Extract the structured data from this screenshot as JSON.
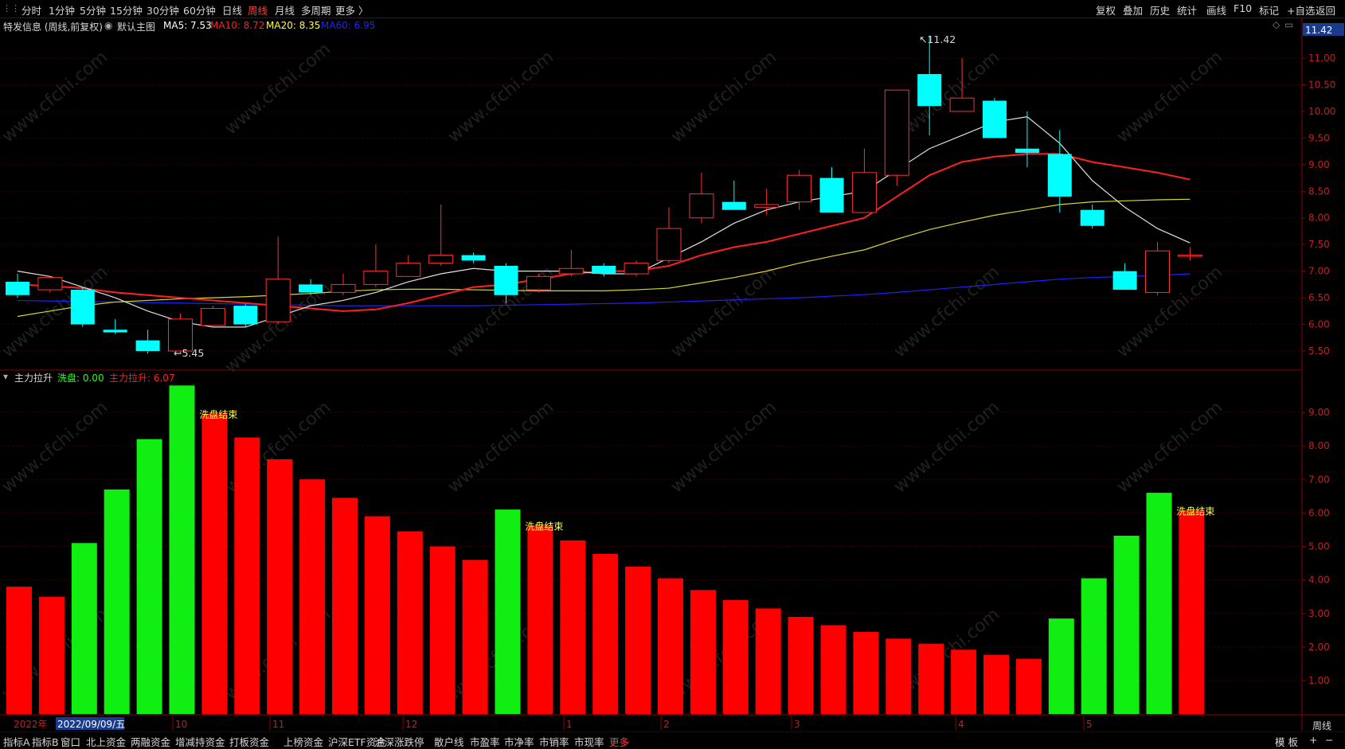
{
  "topbar": {
    "periods": [
      "分时",
      "1分钟",
      "5分钟",
      "15分钟",
      "30分钟",
      "60分钟",
      "日线",
      "周线",
      "月线",
      "多周期",
      "更多 〉"
    ],
    "active_period": "周线",
    "right_tools": [
      "复权",
      "叠加",
      "历史",
      "统计",
      "画线",
      "F10",
      "标记",
      "+自选",
      "返回"
    ]
  },
  "main_chart": {
    "stock_label": "特发信息 (周线,前复权)",
    "template_label": "默认主图",
    "ma5": {
      "label": "MA5: 7.53",
      "color": "#ffffff"
    },
    "ma10": {
      "label": "MA10: 8.72",
      "color": "#ff2020"
    },
    "ma20": {
      "label": "MA20: 8.35",
      "color": "#ffff40"
    },
    "ma60": {
      "label": "MA60: 6.95",
      "color": "#2020ff"
    },
    "high_marker": "11.42",
    "low_marker": "5.45",
    "price_badge": "11.42",
    "y_ticks": [
      "11.00",
      "10.50",
      "10.00",
      "9.50",
      "9.00",
      "8.50",
      "8.00",
      "7.50",
      "7.00",
      "6.50",
      "6.00",
      "5.50"
    ]
  },
  "sub_chart": {
    "indicator_label": "主力拉升",
    "wash_label": "洗盘: 0.00",
    "lift_label": "主力拉升: 6.07",
    "annotations": [
      "洗盘结束",
      "洗盘结束",
      "洗盘结束"
    ],
    "y_ticks": [
      "9.00",
      "8.00",
      "7.00",
      "6.00",
      "5.00",
      "4.00",
      "3.00",
      "2.00",
      "1.00"
    ]
  },
  "time_axis": {
    "year": "2022年",
    "cursor_date": "2022/09/09/五",
    "months": [
      "10",
      "11",
      "12",
      "1",
      "2",
      "3",
      "4",
      "5"
    ],
    "period_label": "周线"
  },
  "bottom_tabs": [
    "指标A",
    "指标B",
    "窗口",
    "北上资金",
    "两融资金",
    "增减持资金",
    "打板资金",
    "上榜资金",
    "沪深ETF资金",
    "沪深涨跌停",
    "散户线",
    "市盈率",
    "市净率",
    "市销率",
    "市现率",
    "更多"
  ],
  "bottom_right": [
    "模 板",
    "+",
    "−"
  ],
  "watermark": "www.cfchi.com",
  "chart_data": {
    "type": "candlestick",
    "candles": [
      {
        "o": 6.8,
        "c": 6.55,
        "h": 6.95,
        "l": 6.5
      },
      {
        "o": 6.65,
        "c": 6.88,
        "h": 6.9,
        "l": 6.6
      },
      {
        "o": 6.65,
        "c": 6.0,
        "h": 6.7,
        "l": 5.95
      },
      {
        "o": 5.9,
        "c": 5.85,
        "h": 6.1,
        "l": 5.82
      },
      {
        "o": 5.7,
        "c": 5.5,
        "h": 5.9,
        "l": 5.45
      },
      {
        "o": 5.5,
        "c": 6.1,
        "h": 6.2,
        "l": 5.45
      },
      {
        "o": 5.98,
        "c": 6.3,
        "h": 6.35,
        "l": 5.95
      },
      {
        "o": 6.35,
        "c": 6.0,
        "h": 6.38,
        "l": 5.95
      },
      {
        "o": 6.05,
        "c": 6.85,
        "h": 7.65,
        "l": 6.0
      },
      {
        "o": 6.75,
        "c": 6.6,
        "h": 6.85,
        "l": 6.55
      },
      {
        "o": 6.6,
        "c": 6.75,
        "h": 6.95,
        "l": 6.55
      },
      {
        "o": 6.75,
        "c": 7.0,
        "h": 7.5,
        "l": 6.7
      },
      {
        "o": 6.9,
        "c": 7.15,
        "h": 7.3,
        "l": 6.9
      },
      {
        "o": 7.15,
        "c": 7.3,
        "h": 8.25,
        "l": 7.1
      },
      {
        "o": 7.3,
        "c": 7.2,
        "h": 7.35,
        "l": 7.15
      },
      {
        "o": 7.1,
        "c": 6.55,
        "h": 7.15,
        "l": 6.4
      },
      {
        "o": 6.65,
        "c": 6.9,
        "h": 6.95,
        "l": 6.6
      },
      {
        "o": 6.95,
        "c": 7.05,
        "h": 7.4,
        "l": 6.9
      },
      {
        "o": 7.1,
        "c": 6.95,
        "h": 7.15,
        "l": 6.9
      },
      {
        "o": 6.95,
        "c": 7.15,
        "h": 7.2,
        "l": 6.9
      },
      {
        "o": 7.2,
        "c": 7.8,
        "h": 8.2,
        "l": 7.15
      },
      {
        "o": 8.0,
        "c": 8.45,
        "h": 8.85,
        "l": 7.9
      },
      {
        "o": 8.3,
        "c": 8.15,
        "h": 8.7,
        "l": 8.15
      },
      {
        "o": 8.2,
        "c": 8.25,
        "h": 8.55,
        "l": 8.05
      },
      {
        "o": 8.3,
        "c": 8.8,
        "h": 8.9,
        "l": 8.15
      },
      {
        "o": 8.75,
        "c": 8.1,
        "h": 8.95,
        "l": 8.1
      },
      {
        "o": 8.1,
        "c": 8.85,
        "h": 9.3,
        "l": 8.1
      },
      {
        "o": 8.8,
        "c": 10.4,
        "h": 10.4,
        "l": 8.6
      },
      {
        "o": 10.7,
        "c": 10.1,
        "h": 11.42,
        "l": 9.55
      },
      {
        "o": 10.0,
        "c": 10.25,
        "h": 11.0,
        "l": 10.0
      },
      {
        "o": 10.2,
        "c": 9.5,
        "h": 10.25,
        "l": 9.5
      },
      {
        "o": 9.3,
        "c": 9.22,
        "h": 10.0,
        "l": 8.95
      },
      {
        "o": 9.2,
        "c": 8.4,
        "h": 9.65,
        "l": 8.1
      },
      {
        "o": 8.15,
        "c": 7.85,
        "h": 8.25,
        "l": 7.8
      },
      {
        "o": 7.0,
        "c": 6.65,
        "h": 7.15,
        "l": 6.65
      },
      {
        "o": 6.6,
        "c": 7.38,
        "h": 7.55,
        "l": 6.55
      },
      {
        "o": 7.28,
        "c": 7.3,
        "h": 7.45,
        "l": 7.2
      }
    ],
    "ma5": [
      7.0,
      6.9,
      6.7,
      6.5,
      6.25,
      6.05,
      5.95,
      5.95,
      6.15,
      6.35,
      6.45,
      6.6,
      6.8,
      6.95,
      7.05,
      7.0,
      7.0,
      7.0,
      6.95,
      6.95,
      7.25,
      7.55,
      7.9,
      8.15,
      8.3,
      8.4,
      8.5,
      8.9,
      9.3,
      9.55,
      9.8,
      9.9,
      9.4,
      8.7,
      8.2,
      7.8,
      7.53
    ],
    "ma10": [
      6.75,
      6.72,
      6.68,
      6.6,
      6.55,
      6.5,
      6.45,
      6.4,
      6.35,
      6.3,
      6.25,
      6.28,
      6.4,
      6.55,
      6.7,
      6.75,
      6.85,
      6.95,
      7.0,
      7.0,
      7.1,
      7.3,
      7.45,
      7.55,
      7.7,
      7.85,
      8.0,
      8.4,
      8.8,
      9.05,
      9.15,
      9.2,
      9.2,
      9.05,
      8.95,
      8.85,
      8.72
    ],
    "ma20": [
      6.15,
      6.25,
      6.35,
      6.42,
      6.45,
      6.48,
      6.5,
      6.52,
      6.55,
      6.58,
      6.62,
      6.65,
      6.66,
      6.66,
      6.65,
      6.64,
      6.63,
      6.63,
      6.63,
      6.65,
      6.68,
      6.78,
      6.88,
      7.0,
      7.15,
      7.28,
      7.4,
      7.6,
      7.78,
      7.92,
      8.05,
      8.15,
      8.25,
      8.3,
      8.32,
      8.34,
      8.35
    ],
    "ma60": [
      6.45,
      6.44,
      6.43,
      6.42,
      6.41,
      6.4,
      6.39,
      6.38,
      6.37,
      6.36,
      6.35,
      6.35,
      6.35,
      6.35,
      6.35,
      6.36,
      6.37,
      6.38,
      6.39,
      6.4,
      6.42,
      6.44,
      6.46,
      6.48,
      6.5,
      6.53,
      6.56,
      6.6,
      6.65,
      6.7,
      6.75,
      6.8,
      6.85,
      6.88,
      6.9,
      6.92,
      6.95
    ],
    "bars": [
      {
        "v": 3.8,
        "c": "red"
      },
      {
        "v": 3.5,
        "c": "red"
      },
      {
        "v": 5.1,
        "c": "green"
      },
      {
        "v": 6.7,
        "c": "green"
      },
      {
        "v": 8.2,
        "c": "green"
      },
      {
        "v": 9.8,
        "c": "green"
      },
      {
        "v": 8.95,
        "c": "red"
      },
      {
        "v": 8.25,
        "c": "red"
      },
      {
        "v": 7.6,
        "c": "red"
      },
      {
        "v": 7.0,
        "c": "red"
      },
      {
        "v": 6.45,
        "c": "red"
      },
      {
        "v": 5.9,
        "c": "red"
      },
      {
        "v": 5.45,
        "c": "red"
      },
      {
        "v": 5.0,
        "c": "red"
      },
      {
        "v": 4.6,
        "c": "red"
      },
      {
        "v": 6.1,
        "c": "green"
      },
      {
        "v": 5.62,
        "c": "red"
      },
      {
        "v": 5.18,
        "c": "red"
      },
      {
        "v": 4.78,
        "c": "red"
      },
      {
        "v": 4.4,
        "c": "red"
      },
      {
        "v": 4.05,
        "c": "red"
      },
      {
        "v": 3.7,
        "c": "red"
      },
      {
        "v": 3.4,
        "c": "red"
      },
      {
        "v": 3.15,
        "c": "red"
      },
      {
        "v": 2.9,
        "c": "red"
      },
      {
        "v": 2.65,
        "c": "red"
      },
      {
        "v": 2.45,
        "c": "red"
      },
      {
        "v": 2.25,
        "c": "red"
      },
      {
        "v": 2.1,
        "c": "red"
      },
      {
        "v": 1.92,
        "c": "red"
      },
      {
        "v": 1.77,
        "c": "red"
      },
      {
        "v": 1.65,
        "c": "red"
      },
      {
        "v": 2.85,
        "c": "green"
      },
      {
        "v": 4.05,
        "c": "green"
      },
      {
        "v": 5.32,
        "c": "green"
      },
      {
        "v": 6.6,
        "c": "green"
      },
      {
        "v": 6.07,
        "c": "red"
      }
    ],
    "annotation_indices": [
      6,
      16,
      36
    ]
  }
}
